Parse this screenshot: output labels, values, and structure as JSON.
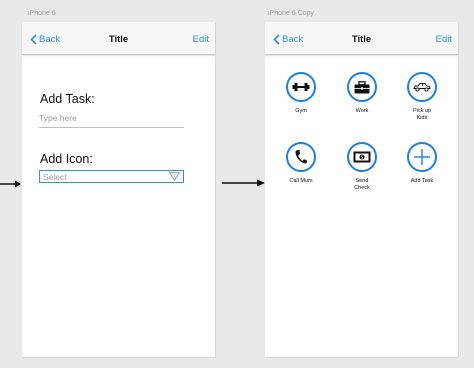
{
  "artboards": [
    {
      "label": "iPhone 6"
    },
    {
      "label": "iPhone 6 Copy"
    }
  ],
  "screen1": {
    "nav": {
      "back_label": "Back",
      "title": "Title",
      "edit_label": "Edit"
    },
    "task_heading": "Add Task:",
    "task_placeholder": "Type here",
    "icon_heading": "Add Icon:",
    "select_value": "Select"
  },
  "screen2": {
    "nav": {
      "back_label": "Back",
      "title": "Title",
      "edit_label": "Edit"
    },
    "items": [
      {
        "label": "Gym",
        "icon": "dumbbell-icon"
      },
      {
        "label": "Work",
        "icon": "briefcase-icon"
      },
      {
        "label": "Pick up\nKids",
        "icon": "car-icon"
      },
      {
        "label": "Call Mum",
        "icon": "phone-icon"
      },
      {
        "label": "Send\nCheck",
        "icon": "money-icon"
      },
      {
        "label": "Add Task",
        "icon": "plus-icon"
      }
    ]
  },
  "colors": {
    "accent": "#2b8ef0",
    "circle": "#1f7fe0",
    "background": "#e9e9e9"
  }
}
